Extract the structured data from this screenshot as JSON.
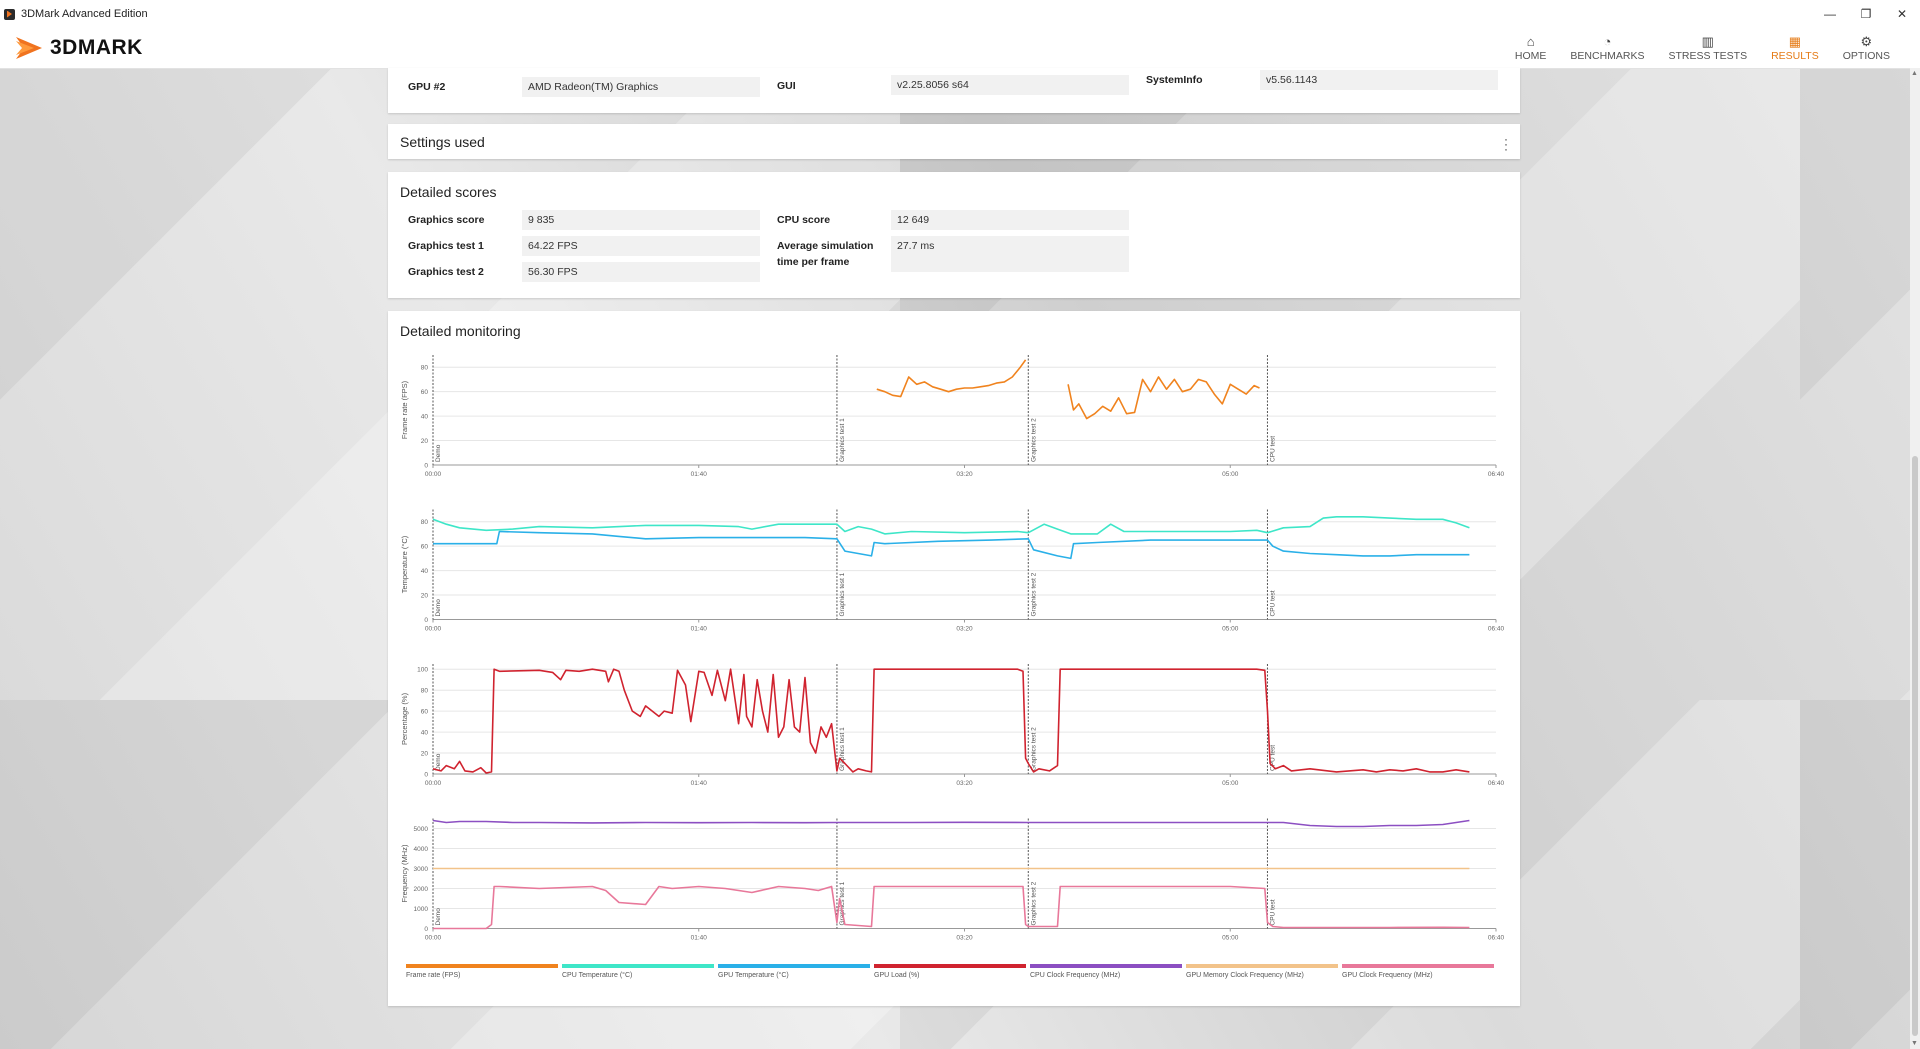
{
  "window": {
    "title": "3DMark Advanced Edition",
    "min": "—",
    "restore": "❐",
    "close": "✕"
  },
  "logo": {
    "text": "3DMARK"
  },
  "nav": [
    {
      "label": "HOME",
      "icon": "home-icon",
      "glyph": "⌂",
      "active": false
    },
    {
      "label": "BENCHMARKS",
      "icon": "gauge-icon",
      "glyph": "◔",
      "active": false
    },
    {
      "label": "STRESS TESTS",
      "icon": "bar-chart-icon",
      "glyph": "▥",
      "active": false
    },
    {
      "label": "RESULTS",
      "icon": "results-icon",
      "glyph": "▦",
      "active": true
    },
    {
      "label": "OPTIONS",
      "icon": "gear-icon",
      "glyph": "⚙",
      "active": false
    }
  ],
  "sysinfo": {
    "gpu2_label": "GPU #2",
    "gpu2_value": "AMD Radeon(TM) Graphics",
    "gui_label": "GUI",
    "gui_value": "v2.25.8056 s64",
    "systeminfo_label": "SystemInfo",
    "systeminfo_value": "v5.56.1143"
  },
  "settings": {
    "title": "Settings used"
  },
  "scores": {
    "title": "Detailed scores",
    "graphics_score_label": "Graphics score",
    "graphics_score": "9 835",
    "graphics_test1_label": "Graphics test 1",
    "graphics_test1": "64.22 FPS",
    "graphics_test2_label": "Graphics test 2",
    "graphics_test2": "56.30 FPS",
    "cpu_score_label": "CPU score",
    "cpu_score": "12 649",
    "avg_sim_label_1": "Average simulation",
    "avg_sim_label_2": "time per frame",
    "avg_sim": "27.7 ms"
  },
  "monitoring": {
    "title": "Detailed monitoring",
    "x_ticks": [
      "00:00",
      "01:40",
      "03:20",
      "05:00",
      "06:40"
    ],
    "x_max_s": 400,
    "phases": [
      {
        "label": "Demo",
        "start_s": 0
      },
      {
        "label": "Graphics test 1",
        "start_s": 152
      },
      {
        "label": "Graphics test 2",
        "start_s": 224
      },
      {
        "label": "CPU test",
        "start_s": 314
      }
    ],
    "legend": [
      {
        "label": "Frame rate (FPS)",
        "color": "#f0831e"
      },
      {
        "label": "CPU Temperature (°C)",
        "color": "#3ee6c8"
      },
      {
        "label": "GPU Temperature (°C)",
        "color": "#2ab0e8"
      },
      {
        "label": "GPU Load (%)",
        "color": "#d0232f"
      },
      {
        "label": "CPU Clock Frequency (MHz)",
        "color": "#8c4fc2"
      },
      {
        "label": "GPU Memory Clock Frequency (MHz)",
        "color": "#f2c38a"
      },
      {
        "label": "GPU Clock Frequency (MHz)",
        "color": "#e8789a"
      }
    ]
  },
  "chart_data": [
    {
      "type": "line",
      "ylabel": "Frame rate (FPS)",
      "ylim": [
        0,
        90
      ],
      "yticks": [
        0,
        20,
        40,
        60,
        80
      ],
      "xlabel": "",
      "series": [
        {
          "name": "Frame rate (FPS)",
          "color": "#f0831e",
          "x": [
            167,
            170,
            173,
            176,
            179,
            182,
            185,
            188,
            191,
            194,
            197,
            200,
            203,
            206,
            209,
            212,
            215,
            218,
            221,
            223
          ],
          "y": [
            62,
            60,
            57,
            56,
            72,
            66,
            68,
            64,
            62,
            60,
            62,
            63,
            63,
            64,
            65,
            67,
            68,
            72,
            80,
            86
          ]
        },
        {
          "name": "Frame rate (FPS)",
          "color": "#f0831e",
          "x": [
            239,
            241,
            243,
            246,
            249,
            252,
            255,
            258,
            261,
            264,
            267,
            270,
            273,
            276,
            279,
            282,
            285,
            288,
            291,
            294,
            297,
            300,
            303,
            306,
            309,
            311
          ],
          "y": [
            66,
            45,
            50,
            38,
            42,
            48,
            44,
            55,
            42,
            43,
            70,
            60,
            72,
            62,
            70,
            60,
            62,
            70,
            68,
            58,
            50,
            66,
            62,
            58,
            65,
            63
          ]
        }
      ]
    },
    {
      "type": "line",
      "ylabel": "Temperature (°C)",
      "ylim": [
        0,
        90
      ],
      "yticks": [
        0,
        20,
        40,
        60,
        80
      ],
      "xlabel": "",
      "series": [
        {
          "name": "CPU Temperature (°C)",
          "color": "#3ee6c8",
          "x": [
            0,
            5,
            10,
            15,
            20,
            30,
            40,
            60,
            80,
            100,
            115,
            120,
            130,
            140,
            152,
            155,
            160,
            165,
            170,
            180,
            200,
            220,
            224,
            230,
            235,
            240,
            250,
            255,
            260,
            280,
            300,
            310,
            314,
            320,
            330,
            335,
            340,
            350,
            360,
            370,
            380,
            385,
            390
          ],
          "y": [
            82,
            78,
            75,
            74,
            73,
            74,
            76,
            75,
            77,
            77,
            76,
            74,
            78,
            78,
            78,
            72,
            76,
            74,
            70,
            72,
            71,
            72,
            71,
            78,
            74,
            70,
            70,
            78,
            72,
            72,
            72,
            73,
            71,
            75,
            76,
            83,
            84,
            84,
            83,
            82,
            82,
            79,
            75
          ]
        },
        {
          "name": "GPU Temperature (°C)",
          "color": "#2ab0e8",
          "x": [
            0,
            10,
            20,
            24,
            25,
            40,
            60,
            70,
            80,
            100,
            120,
            140,
            152,
            155,
            160,
            165,
            166,
            170,
            190,
            210,
            224,
            226,
            235,
            240,
            241,
            250,
            270,
            290,
            314,
            316,
            320,
            330,
            340,
            350,
            360,
            370,
            390
          ],
          "y": [
            62,
            62,
            62,
            62,
            72,
            71,
            70,
            68,
            66,
            67,
            67,
            67,
            66,
            56,
            54,
            52,
            63,
            62,
            64,
            65,
            66,
            57,
            52,
            50,
            62,
            63,
            65,
            65,
            65,
            60,
            56,
            54,
            53,
            52,
            52,
            53,
            53
          ]
        }
      ]
    },
    {
      "type": "line",
      "ylabel": "Percentage (%)",
      "ylim": [
        0,
        105
      ],
      "yticks": [
        0,
        20,
        40,
        60,
        80,
        100
      ],
      "xlabel": "",
      "series": [
        {
          "name": "GPU Load (%)",
          "color": "#d0232f",
          "x": [
            0,
            3,
            5,
            8,
            10,
            12,
            15,
            18,
            20,
            22,
            23,
            25,
            40,
            45,
            48,
            50,
            55,
            60,
            65,
            66,
            68,
            70,
            72,
            75,
            78,
            80,
            85,
            87,
            90,
            92,
            95,
            97,
            100,
            102,
            105,
            107,
            110,
            112,
            115,
            117,
            118,
            120,
            122,
            124,
            126,
            128,
            130,
            132,
            134,
            136,
            138,
            140,
            142,
            144,
            146,
            148,
            150,
            152,
            153,
            155,
            158,
            160,
            163,
            165,
            166,
            200,
            205,
            220,
            222,
            223,
            224,
            226,
            228,
            232,
            235,
            236,
            270,
            290,
            310,
            313,
            314,
            315,
            317,
            320,
            323,
            330,
            340,
            350,
            355,
            360,
            365,
            370,
            375,
            380,
            385,
            390
          ],
          "y": [
            5,
            3,
            8,
            5,
            12,
            3,
            2,
            6,
            1,
            2,
            100,
            98,
            99,
            97,
            90,
            99,
            98,
            100,
            98,
            88,
            100,
            98,
            80,
            60,
            55,
            65,
            55,
            60,
            58,
            99,
            85,
            50,
            98,
            97,
            75,
            99,
            70,
            100,
            48,
            95,
            55,
            45,
            90,
            60,
            40,
            95,
            35,
            45,
            90,
            45,
            40,
            92,
            30,
            20,
            45,
            35,
            48,
            3,
            15,
            10,
            2,
            5,
            3,
            2,
            100,
            100,
            100,
            100,
            98,
            15,
            10,
            2,
            5,
            3,
            8,
            100,
            100,
            100,
            100,
            99,
            60,
            10,
            5,
            8,
            3,
            5,
            2,
            4,
            2,
            4,
            3,
            5,
            2,
            2,
            4,
            2
          ]
        }
      ]
    },
    {
      "type": "line",
      "ylabel": "Frequency (MHz)",
      "ylim": [
        0,
        5500
      ],
      "yticks": [
        0,
        1000,
        2000,
        3000,
        4000,
        5000
      ],
      "xlabel": "",
      "series": [
        {
          "name": "CPU Clock Frequency (MHz)",
          "color": "#8c4fc2",
          "x": [
            0,
            5,
            10,
            20,
            30,
            40,
            60,
            80,
            100,
            120,
            140,
            152,
            160,
            180,
            200,
            224,
            240,
            260,
            280,
            300,
            314,
            320,
            330,
            340,
            350,
            360,
            370,
            380,
            385,
            390
          ],
          "y": [
            5400,
            5300,
            5350,
            5350,
            5300,
            5300,
            5280,
            5300,
            5290,
            5300,
            5290,
            5300,
            5300,
            5300,
            5310,
            5300,
            5300,
            5300,
            5300,
            5300,
            5300,
            5300,
            5150,
            5100,
            5100,
            5150,
            5150,
            5200,
            5300,
            5400
          ]
        },
        {
          "name": "GPU Memory Clock Frequency (MHz)",
          "color": "#f2c38a",
          "x": [
            0,
            390
          ],
          "y": [
            3000,
            3000
          ]
        },
        {
          "name": "GPU Clock Frequency (MHz)",
          "color": "#e8789a",
          "x": [
            0,
            20,
            22,
            23,
            25,
            40,
            60,
            65,
            70,
            80,
            85,
            90,
            100,
            110,
            120,
            130,
            140,
            145,
            150,
            152,
            153,
            155,
            165,
            166,
            200,
            222,
            223,
            224,
            235,
            236,
            270,
            300,
            313,
            314,
            316,
            320,
            340,
            360,
            380,
            390
          ],
          "y": [
            0,
            0,
            200,
            2100,
            2100,
            2000,
            2100,
            1900,
            1300,
            1200,
            2100,
            2000,
            2100,
            2000,
            1800,
            2100,
            2000,
            1900,
            2100,
            300,
            1500,
            200,
            100,
            2100,
            2100,
            2100,
            200,
            100,
            100,
            2100,
            2100,
            2100,
            2000,
            300,
            100,
            50,
            50,
            50,
            60,
            50
          ]
        }
      ]
    }
  ]
}
